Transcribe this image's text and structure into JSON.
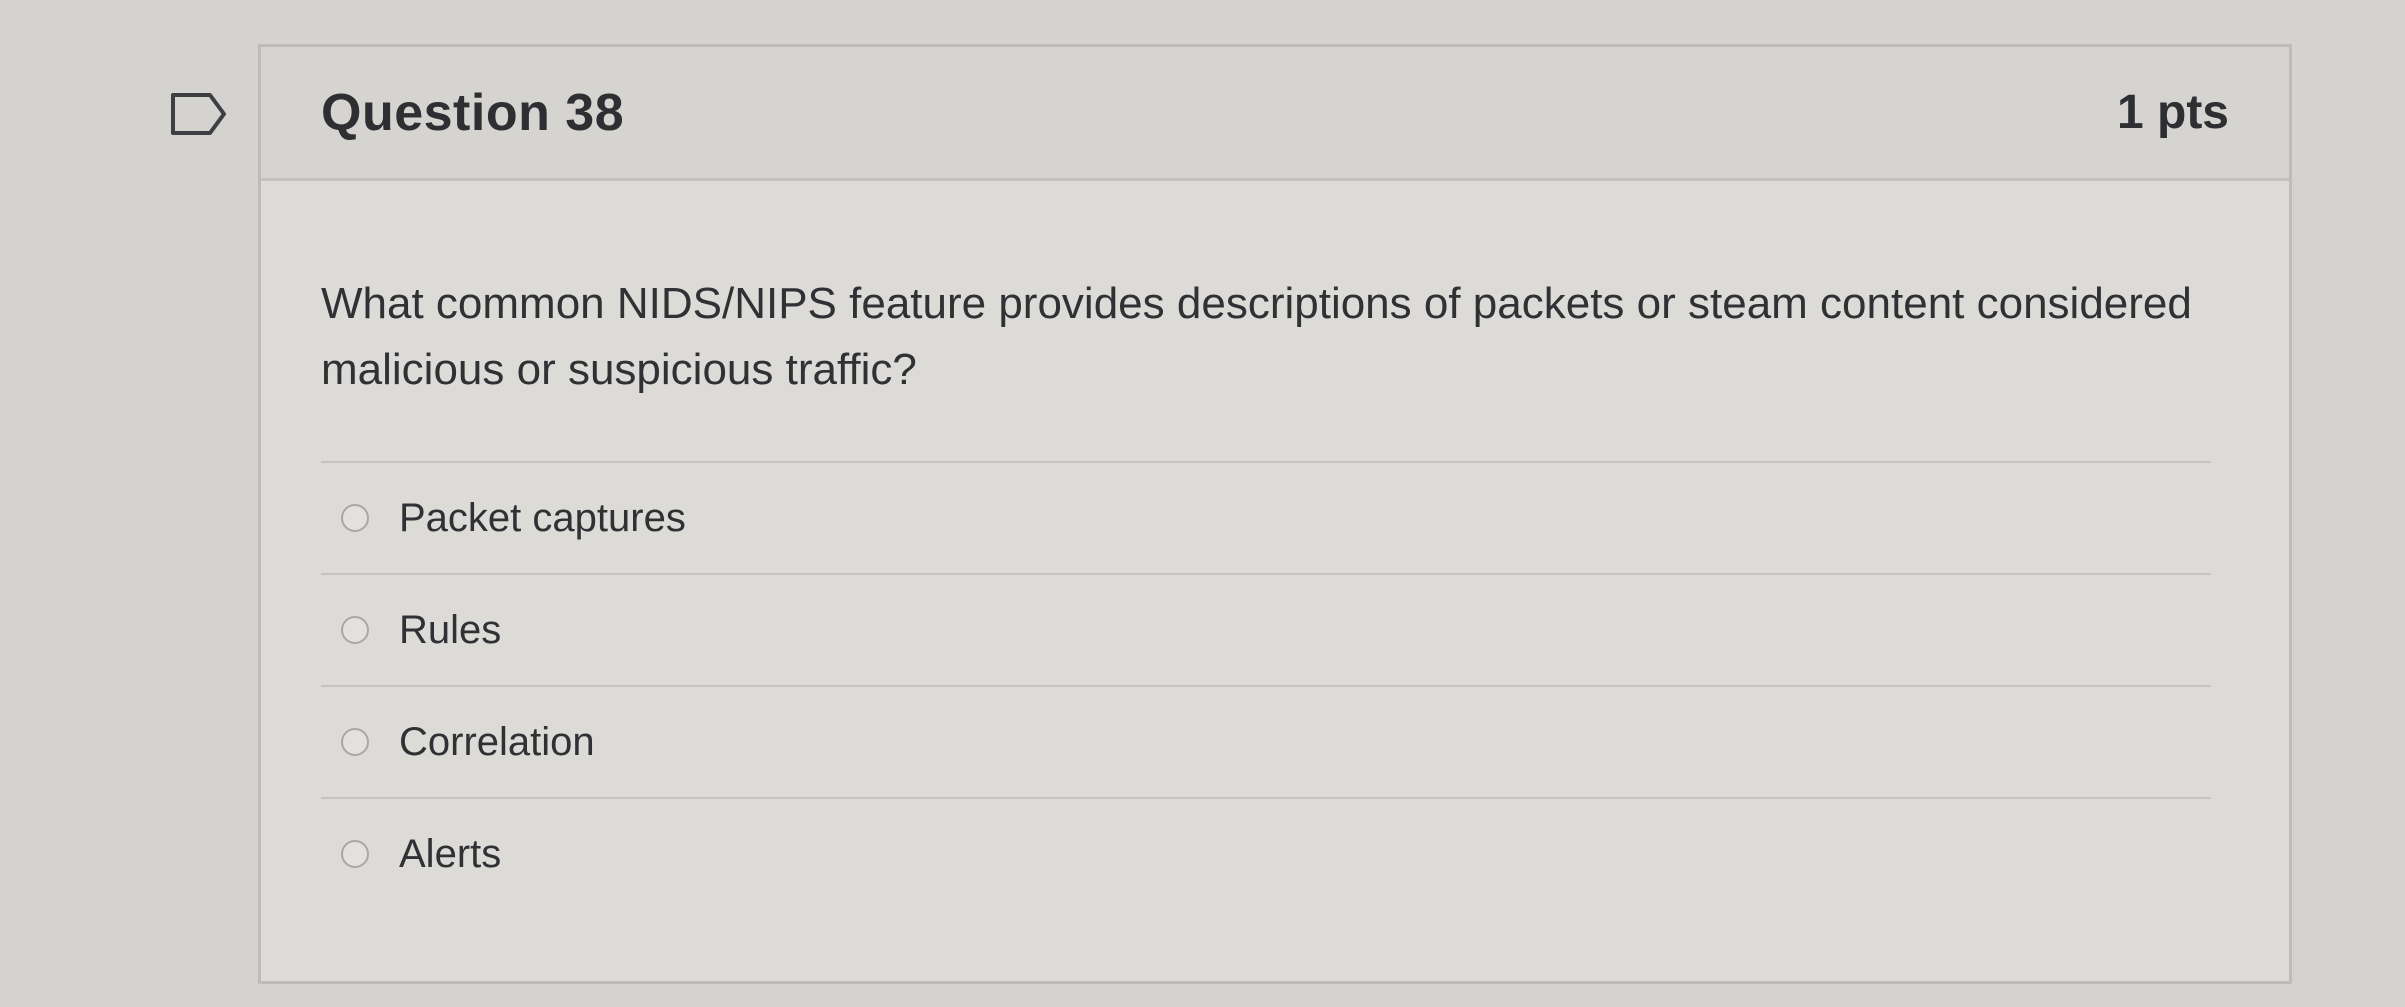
{
  "question": {
    "title": "Question 38",
    "points": "1 pts",
    "text": "What common NIDS/NIPS feature provides descriptions of packets or steam content considered malicious or suspicious traffic?",
    "flag_icon": "flag-icon"
  },
  "answers": [
    {
      "label": "Packet captures",
      "selected": false
    },
    {
      "label": "Rules",
      "selected": false
    },
    {
      "label": "Correlation",
      "selected": false
    },
    {
      "label": "Alerts",
      "selected": false
    }
  ],
  "colors": {
    "background": "#d4d3d0",
    "card": "#dcdbd8",
    "header": "#d5d4d1",
    "text": "#2e3033"
  }
}
